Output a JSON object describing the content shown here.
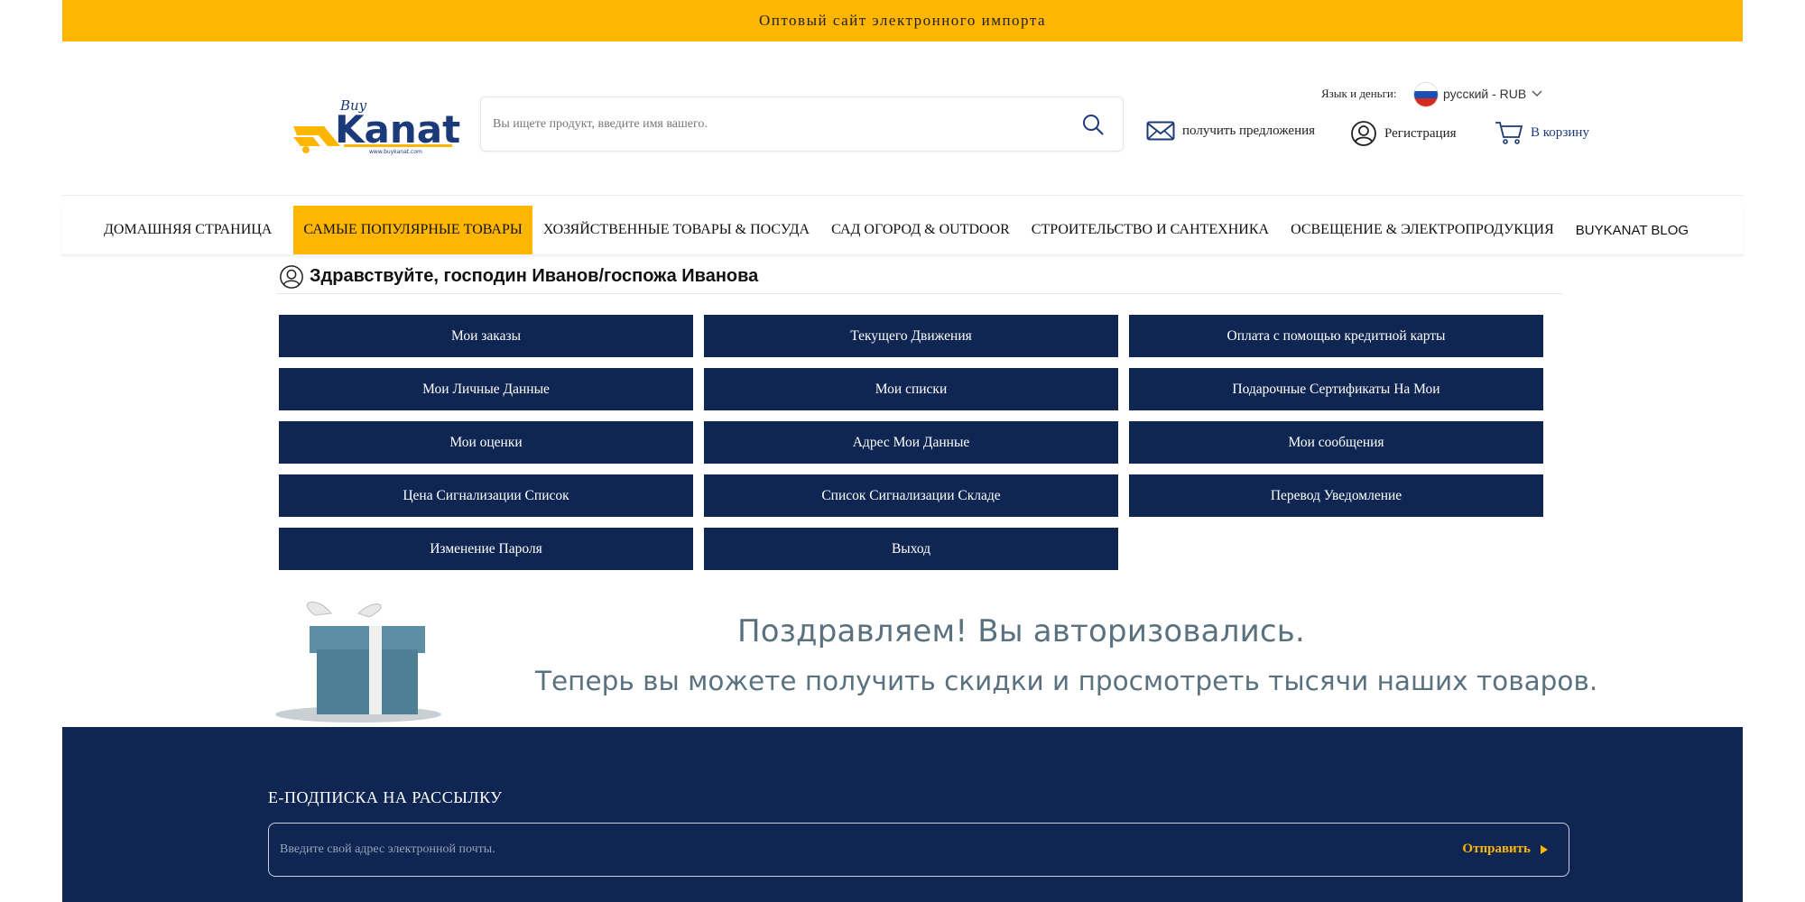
{
  "topbar": {
    "text": "Оптовый сайт электронного импорта"
  },
  "logo": {
    "brand": "Kanat",
    "prefix": "Buy",
    "url_text": "www.buykanat.com"
  },
  "search": {
    "placeholder": "Вы ищете продукт, введите имя вашего."
  },
  "header": {
    "lang_label": "Язык и деньги:",
    "lang_value": "русский - RUB",
    "offers": "получить предложения",
    "register": "Регистрация",
    "cart": "В корзину"
  },
  "nav": {
    "items": [
      "ДОМАШНЯЯ СТРАНИЦА",
      "САМЫЕ ПОПУЛЯРНЫЕ ТОВАРЫ",
      "ХОЗЯЙСТВЕННЫЕ ТОВАРЫ & ПОСУДА",
      "САД ОГОРОД & OUTDOOR",
      "СТРОИТЕЛЬСТВО И САНТЕХНИКА",
      "ОСВЕЩЕНИЕ & ЭЛЕКТРОПРОДУКЦИЯ",
      "BUYKANAT BLOG"
    ]
  },
  "greeting": "Здравствуйте, господин Иванов/госпожа Иванова",
  "account_buttons": [
    "Мои заказы",
    "Текущего Движения",
    "Оплата с помощью кредитной карты",
    "Мои Личные Данные",
    "Мои списки",
    "Подарочные Сертификаты На Мои",
    "Мои оценки",
    "Адрес Мои Данные",
    "Мои сообщения",
    "Цена Сигнализации Список",
    "Список Сигнализации Складе",
    "Перевод Уведомление",
    "Изменение Пароля",
    "Выход"
  ],
  "banner": {
    "line1": "Поздравляем! Вы авторизовались.",
    "line2": "Теперь вы можете получить скидки и просмотреть тысячи наших товаров."
  },
  "footer": {
    "newsletter_title": "E-ПОДПИСКА НА РАССЫЛКУ",
    "email_placeholder": "Введите свой адрес электронной почты.",
    "submit": "Отправить"
  },
  "colors": {
    "accent": "#ffb600",
    "navy": "#0f2552",
    "banner_text": "#5a7280"
  }
}
